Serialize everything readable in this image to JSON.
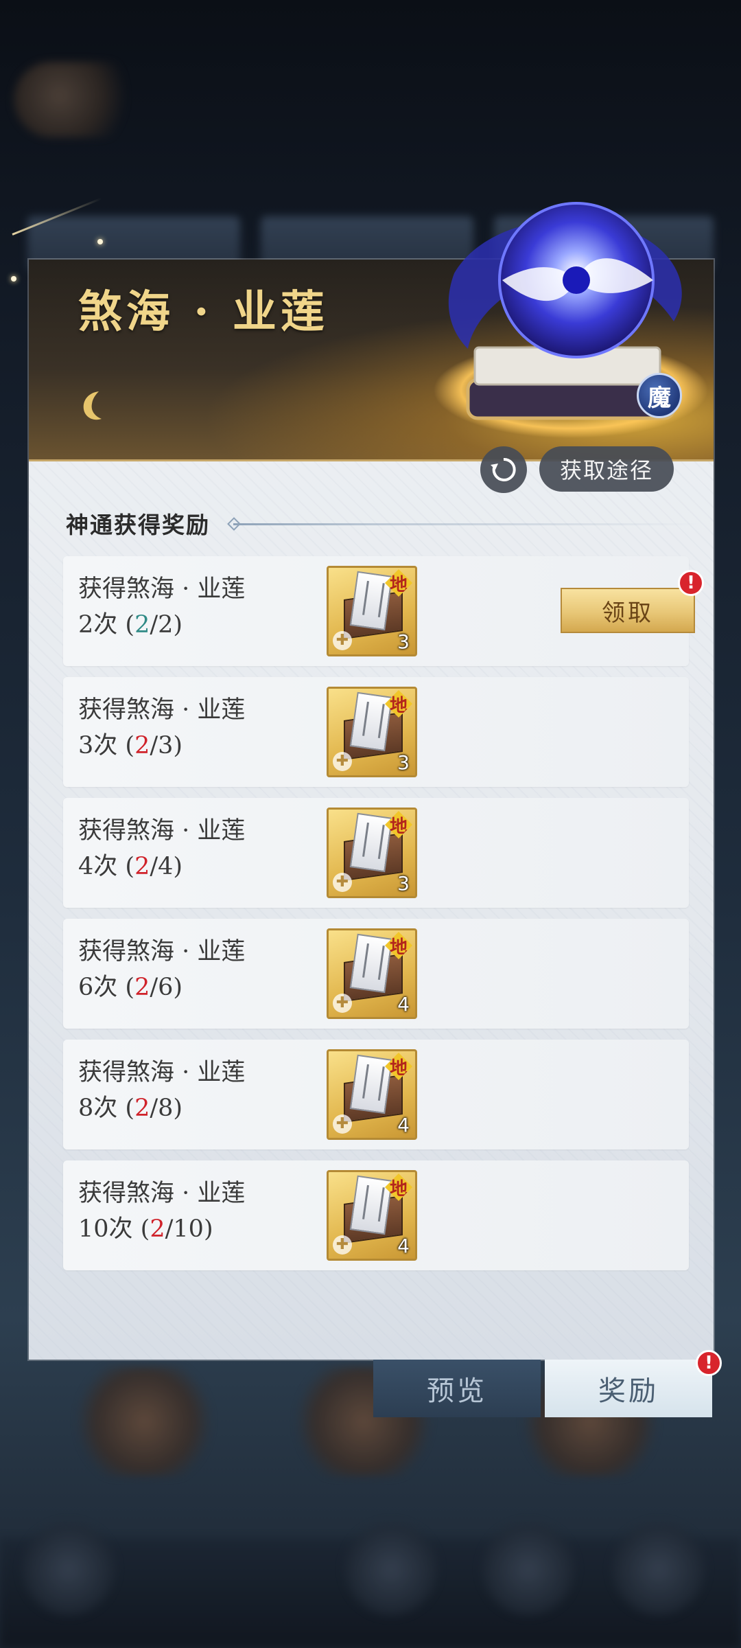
{
  "panel": {
    "title": "煞海 · 业莲",
    "type_badge": "魔",
    "obtain_button": "获取途径",
    "section_title": "神通获得奖励"
  },
  "rewards": [
    {
      "label": "获得煞海 · 业莲",
      "count": "2次",
      "current": "2",
      "target": "2",
      "item_tag": "地",
      "item_qty": "3",
      "claim": "领取",
      "claimable": true
    },
    {
      "label": "获得煞海 · 业莲",
      "count": "3次",
      "current": "2",
      "target": "3",
      "item_tag": "地",
      "item_qty": "3",
      "claimable": false
    },
    {
      "label": "获得煞海 · 业莲",
      "count": "4次",
      "current": "2",
      "target": "4",
      "item_tag": "地",
      "item_qty": "3",
      "claimable": false
    },
    {
      "label": "获得煞海 · 业莲",
      "count": "6次",
      "current": "2",
      "target": "6",
      "item_tag": "地",
      "item_qty": "4",
      "claimable": false
    },
    {
      "label": "获得煞海 · 业莲",
      "count": "8次",
      "current": "2",
      "target": "8",
      "item_tag": "地",
      "item_qty": "4",
      "claimable": false
    },
    {
      "label": "获得煞海 · 业莲",
      "count": "10次",
      "current": "2",
      "target": "10",
      "item_tag": "地",
      "item_qty": "4",
      "claimable": false
    }
  ],
  "bottom_tabs": {
    "preview": "预览",
    "reward": "奖励"
  },
  "badges": {
    "alert": "!"
  },
  "colors": {
    "title_gold": "#f0d58a",
    "progress_complete": "#2f8a86",
    "progress_incomplete": "#d0222a",
    "alert_red": "#d8242c"
  }
}
